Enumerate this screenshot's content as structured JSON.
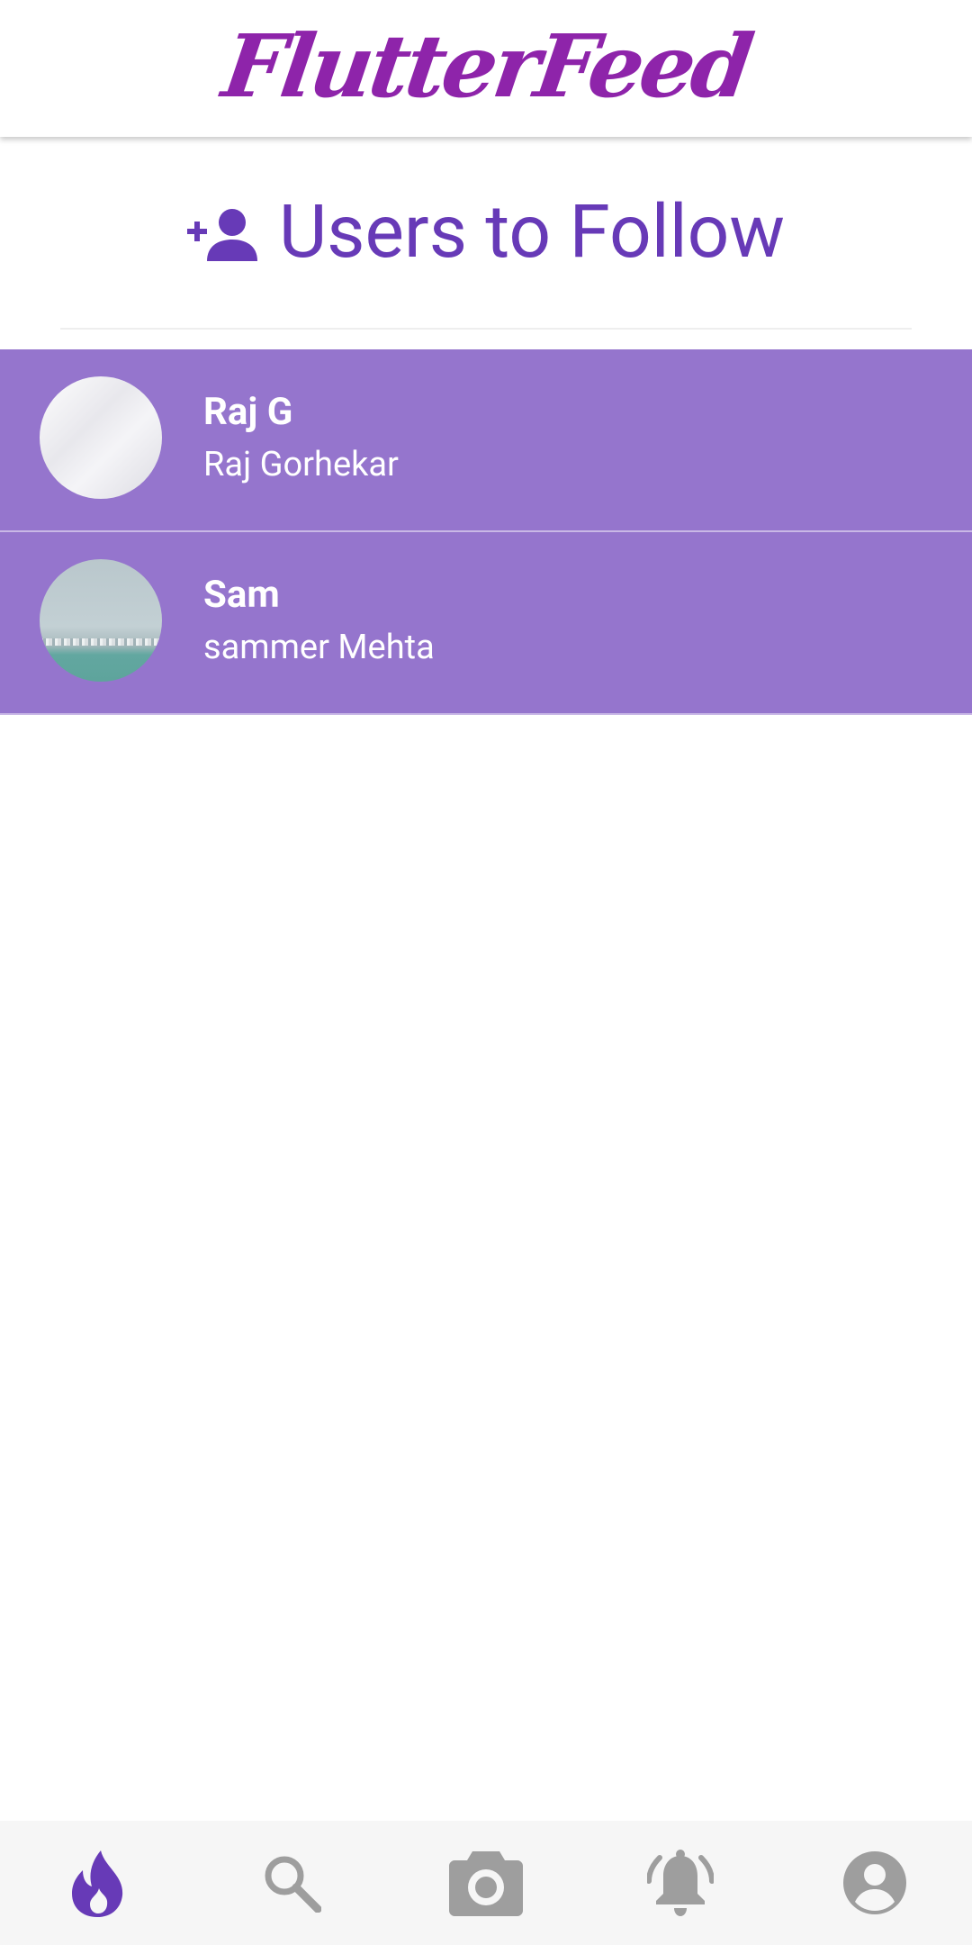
{
  "app_bar": {
    "title": "FlutterFeed"
  },
  "header": {
    "icon": "person-add-icon",
    "title": "Users to Follow"
  },
  "users": [
    {
      "username": "Raj G",
      "display_name": "Raj Gorhekar",
      "avatar": "avatar-image"
    },
    {
      "username": "Sam",
      "display_name": "sammer Mehta",
      "avatar": "avatar-image"
    }
  ],
  "bottom_nav": {
    "items": [
      {
        "icon": "flame-icon",
        "active": true
      },
      {
        "icon": "search-icon",
        "active": false
      },
      {
        "icon": "camera-icon",
        "active": false
      },
      {
        "icon": "bell-ringing-icon",
        "active": false
      },
      {
        "icon": "account-circle-icon",
        "active": false
      }
    ]
  },
  "colors": {
    "primary": "#673ab7",
    "title": "#8e24aa",
    "list_item_bg": "#9575cd",
    "nav_active": "#673ab7",
    "nav_inactive": "#9e9e9e",
    "nav_bg": "#f6f6f6"
  }
}
